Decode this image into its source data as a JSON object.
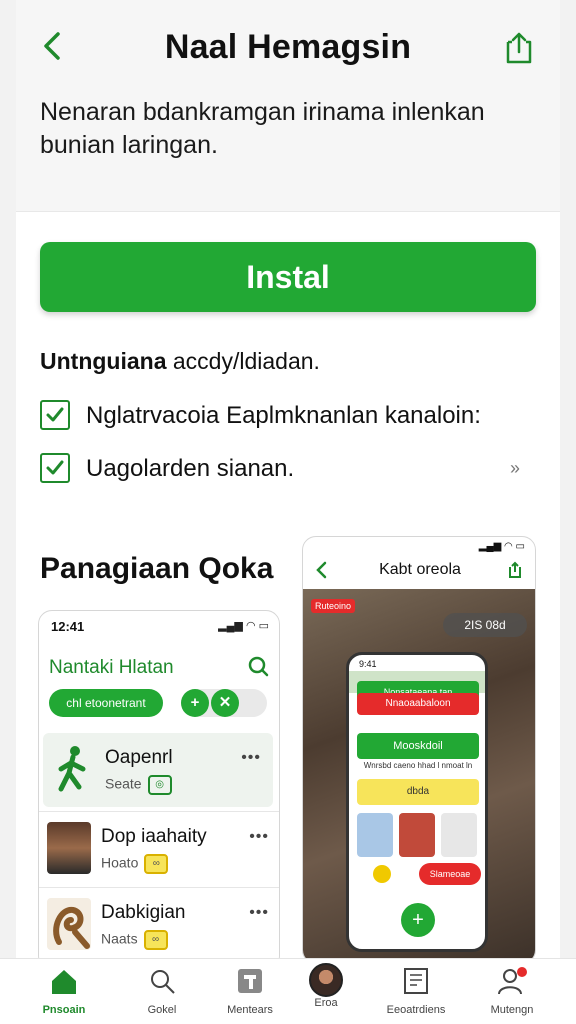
{
  "header": {
    "title": "Naal Hemagsin",
    "back_icon": "chevron-left-icon",
    "share_icon": "share-icon"
  },
  "description": "Nenaran bdankramgan irinama inlenkan bunian laringan.",
  "install_label": "Instal",
  "subheading": {
    "bold": "Untnguiana",
    "rest": " accdy/ldiadan."
  },
  "checks": [
    {
      "label": "Nglatrvacoia  Eaplmknanlan kanaloin:"
    },
    {
      "label": "Uagolarden sianan."
    }
  ],
  "chevrons": "››",
  "section_title": "Panagiaan Qoka",
  "left_phone": {
    "time": "12:41",
    "status": "▂▄▆ ◠ ▭",
    "app_title": "Nantaki Hlatan",
    "chip": "chl etoonetrant",
    "rows": [
      {
        "name": "Oapenrl",
        "sub": "Seate",
        "badge": "◎"
      },
      {
        "name": "Dop iaahaity",
        "sub": "Hoato",
        "badge": "∞"
      },
      {
        "name": "Dabkigian",
        "sub": "Naats",
        "badge": "∞"
      }
    ],
    "more": "•••"
  },
  "right_phone": {
    "title": "Kabt oreola",
    "time": "9:41",
    "status": "▂▄▆ ◠ ▭",
    "red_tag": "Ruteoino",
    "date_tag": "2IS 08d",
    "inner": {
      "time": "9:41",
      "banner": "Nonsataeana tan",
      "red": "Nnaoaabaloon",
      "green": "Mooskdoil",
      "text": "Wnrsbd caeno hhad l nmoat ln",
      "yellow": "dbda",
      "bottom_red": "Slameoae"
    }
  },
  "tabs": [
    {
      "label": "Pnsoain",
      "icon": "home-icon"
    },
    {
      "label": "Gokel",
      "icon": "search-icon"
    },
    {
      "label": "Mentears",
      "icon": "apps-icon"
    },
    {
      "label": "Eroa",
      "icon": "avatar-icon"
    },
    {
      "label": "Eeoatrdiens",
      "icon": "notes-icon"
    },
    {
      "label": "Mutengn",
      "icon": "profile-icon"
    }
  ],
  "colors": {
    "accent": "#22a834",
    "accent_dark": "#1f8a2c",
    "red": "#e52b2b",
    "yellow": "#f7e45a"
  }
}
